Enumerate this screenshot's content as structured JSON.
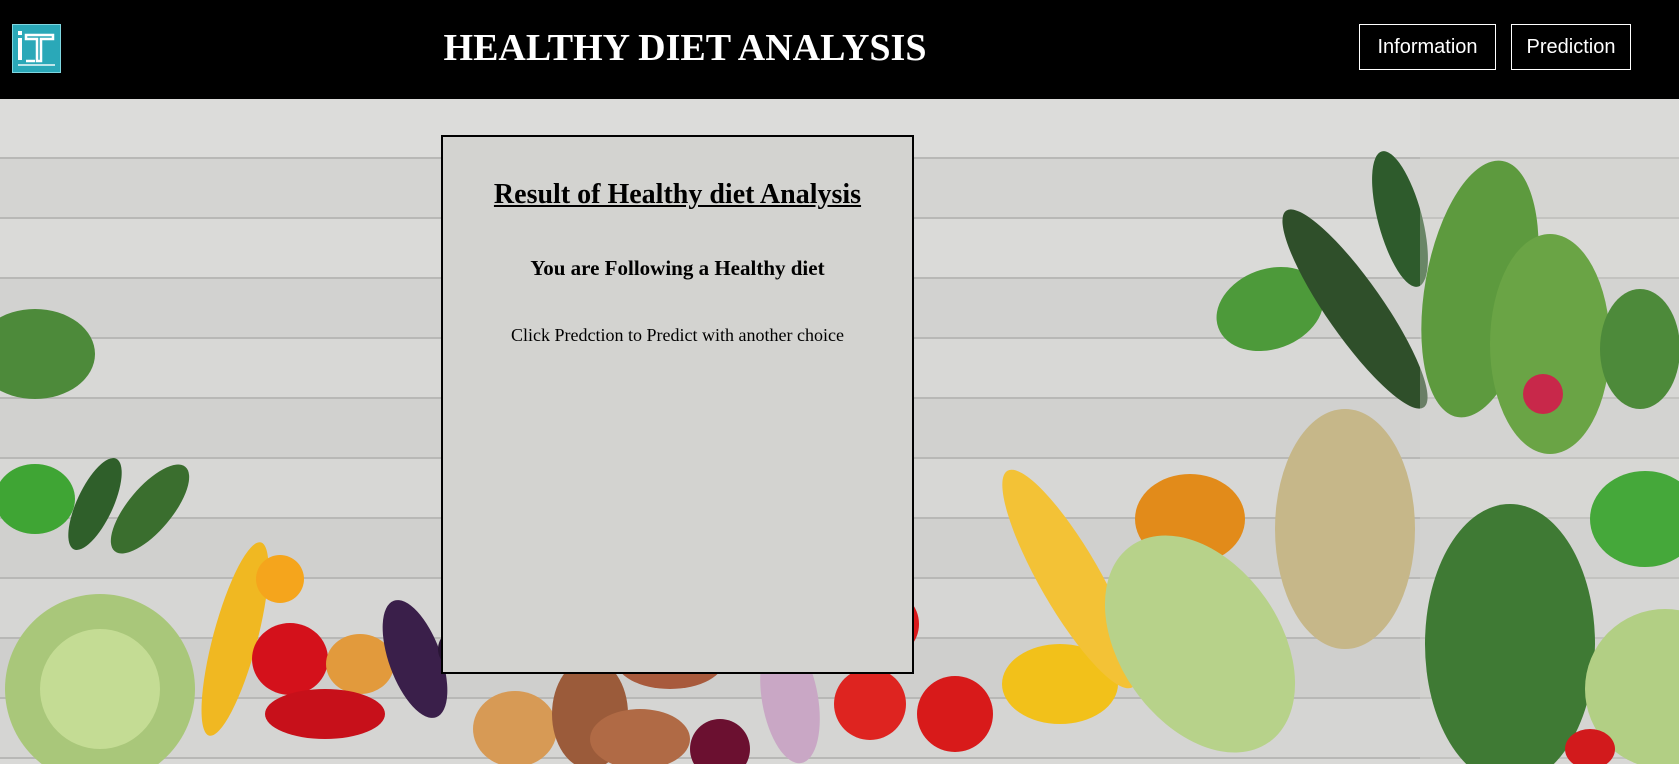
{
  "header": {
    "logo_icon": "ict-academy-logo",
    "title": "HEALTHY DIET ANALYSIS",
    "nav": {
      "information_label": "Information",
      "prediction_label": "Prediction"
    }
  },
  "background": {
    "description_icon": "vegetables-on-wood-photo"
  },
  "result_panel": {
    "heading": "Result of Healthy diet Analysis",
    "result_text": "You are Following a Healthy diet",
    "hint_text": "Click Predction to Predict with another choice"
  },
  "colors": {
    "header_bg": "#000000",
    "header_text": "#ffffff",
    "panel_bg": "#d3d3d0",
    "logo_accent": "#2aa8b8"
  }
}
